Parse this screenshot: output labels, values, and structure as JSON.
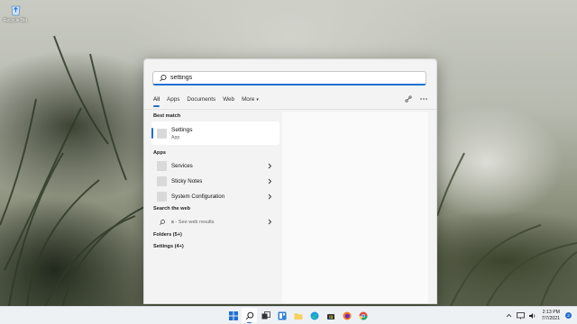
{
  "desktop": {
    "icons": [
      {
        "label": "Recycle Bin",
        "icon": "recycle-bin-icon"
      }
    ]
  },
  "search": {
    "query": "settings",
    "icon": "search-icon"
  },
  "filters": {
    "tabs": [
      "All",
      "Apps",
      "Documents",
      "Web",
      "More"
    ],
    "active": "All",
    "more_caret": "▾",
    "right_icons": [
      "share-icon",
      "more-icon"
    ]
  },
  "best_match": {
    "heading": "Best match",
    "name": "Settings",
    "type": "App"
  },
  "apps": {
    "heading": "Apps",
    "items": [
      "Services",
      "Sticky Notes",
      "System Configuration"
    ]
  },
  "web": {
    "heading": "Search the web",
    "query": "s",
    "suffix": " - See web results"
  },
  "folders": {
    "label": "Folders (5+)"
  },
  "settings_group": {
    "label": "Settings (4+)"
  },
  "taskbar": {
    "items": [
      "start-icon",
      "search-icon",
      "task-view-icon",
      "widgets-icon",
      "file-explorer-icon",
      "edge-icon",
      "store-icon",
      "firefox-icon",
      "chrome-icon"
    ],
    "active": "search-icon"
  },
  "tray": {
    "time": "2:13 PM",
    "date": "7/7/2021",
    "notification_count": "2"
  },
  "colors": {
    "accent": "#1f6fd1",
    "panel": "#f3f3f3",
    "taskbar": "#eef1f4"
  }
}
